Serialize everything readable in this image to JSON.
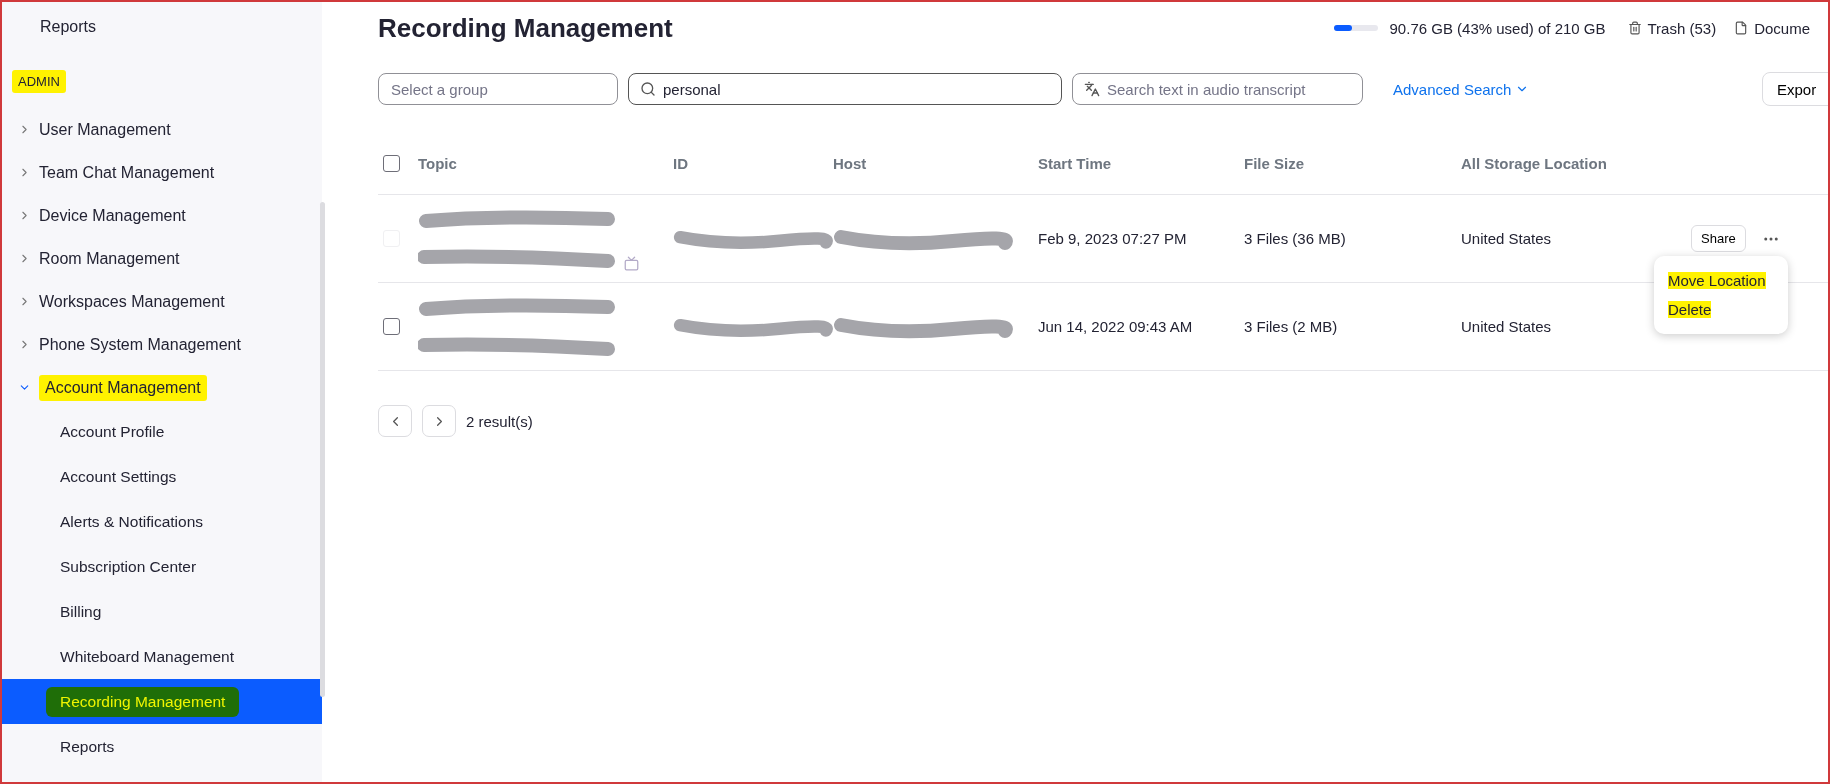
{
  "sidebar": {
    "top_items": [
      {
        "label": "Reports"
      }
    ],
    "section": {
      "label": "ADMIN",
      "highlighted": true
    },
    "items": [
      {
        "label": "User Management",
        "expanded": false,
        "highlighted": false
      },
      {
        "label": "Team Chat Management",
        "expanded": false,
        "highlighted": false
      },
      {
        "label": "Device Management",
        "expanded": false,
        "highlighted": false
      },
      {
        "label": "Room Management",
        "expanded": false,
        "highlighted": false
      },
      {
        "label": "Workspaces Management",
        "expanded": false,
        "highlighted": false
      },
      {
        "label": "Phone System Management",
        "expanded": false,
        "highlighted": false
      },
      {
        "label": "Account Management",
        "expanded": true,
        "highlighted": true,
        "children": [
          {
            "label": "Account Profile",
            "selected": false,
            "highlighted": false
          },
          {
            "label": "Account Settings",
            "selected": false,
            "highlighted": false
          },
          {
            "label": "Alerts & Notifications",
            "selected": false,
            "highlighted": false
          },
          {
            "label": "Subscription Center",
            "selected": false,
            "highlighted": false
          },
          {
            "label": "Billing",
            "selected": false,
            "highlighted": false
          },
          {
            "label": "Whiteboard Management",
            "selected": false,
            "highlighted": false
          },
          {
            "label": "Recording Management",
            "selected": true,
            "highlighted": true
          },
          {
            "label": "Reports",
            "selected": false,
            "highlighted": false
          }
        ]
      }
    ]
  },
  "header": {
    "title": "Recording Management",
    "storage": {
      "level": 0.43,
      "text": "90.76 GB (43% used) of 210 GB"
    },
    "links": [
      {
        "kind": "trash",
        "label": "Trash (53)"
      },
      {
        "kind": "document",
        "label": "Docume"
      }
    ]
  },
  "filters": {
    "group": {
      "placeholder": "Select a group"
    },
    "search": {
      "value": "personal"
    },
    "transcript": {
      "placeholder": "Search text in audio transcript"
    },
    "advanced_search": "Advanced Search",
    "export": "Expor"
  },
  "table": {
    "select_all": {
      "checked": false
    },
    "columns": [
      "Topic",
      "ID",
      "Host",
      "Start Time",
      "File Size",
      "All Storage Location"
    ],
    "rows": [
      {
        "checked": false,
        "faded": true,
        "video": true,
        "actions": {
          "share": "Share"
        },
        "cells": [
          {
            "kind": "redacted-two-line"
          },
          {
            "kind": "redacted"
          },
          {
            "kind": "redacted"
          },
          {
            "kind": "text",
            "text": "Feb 9, 2023 07:27 PM"
          },
          {
            "kind": "text",
            "text": "3 Files (36 MB)"
          },
          {
            "kind": "text",
            "text": "United States"
          }
        ]
      },
      {
        "checked": false,
        "faded": false,
        "video": false,
        "cells": [
          {
            "kind": "redacted-two-line"
          },
          {
            "kind": "redacted"
          },
          {
            "kind": "redacted"
          },
          {
            "kind": "text",
            "text": "Jun 14, 2022 09:43 AM"
          },
          {
            "kind": "text",
            "text": "3 Files (2 MB)"
          },
          {
            "kind": "text",
            "text": "United States"
          }
        ]
      }
    ]
  },
  "menu": {
    "items": [
      {
        "label": "Move Location",
        "highlighted": true
      },
      {
        "label": "Delete",
        "highlighted": true
      }
    ]
  },
  "pagination": {
    "results": "2 result(s)"
  }
}
